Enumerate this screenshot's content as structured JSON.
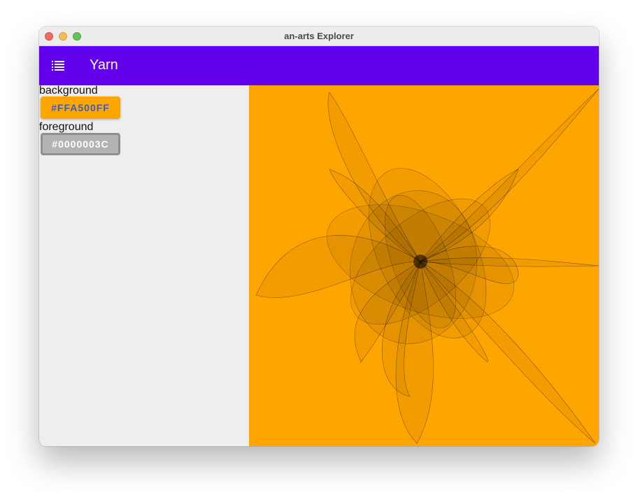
{
  "window": {
    "title": "an-arts Explorer"
  },
  "appbar": {
    "title": "Yarn",
    "menu_icon": "menu-list-icon"
  },
  "settings": {
    "background_label": "background",
    "background_value": "#FFA500FF",
    "foreground_label": "foreground",
    "foreground_value": "#0000003C"
  },
  "colors": {
    "appbar": "#6200ee",
    "canvas_background": "#ffa500",
    "sidebar_background": "#eeeeee",
    "stroke": "#000000"
  }
}
